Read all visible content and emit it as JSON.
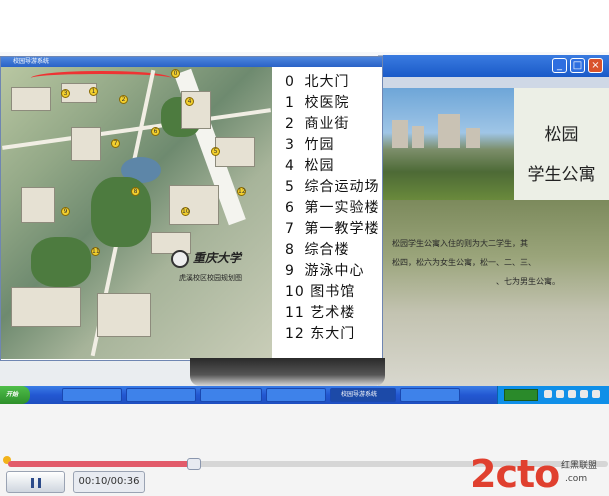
{
  "video": {
    "main_window_title": "校园导游系统",
    "legend": [
      {
        "num": "0",
        "label": "北大门"
      },
      {
        "num": "1",
        "label": "校医院"
      },
      {
        "num": "2",
        "label": "商业街"
      },
      {
        "num": "3",
        "label": "竹园"
      },
      {
        "num": "4",
        "label": "松园"
      },
      {
        "num": "5",
        "label": "综合运动场"
      },
      {
        "num": "6",
        "label": "第一实验楼"
      },
      {
        "num": "7",
        "label": "第一教学楼"
      },
      {
        "num": "8",
        "label": "综合楼"
      },
      {
        "num": "9",
        "label": "游泳中心"
      },
      {
        "num": "10",
        "label": "图书馆"
      },
      {
        "num": "11",
        "label": "艺术楼"
      },
      {
        "num": "12",
        "label": "东大门"
      }
    ],
    "map": {
      "university_name": "重庆大学",
      "campus_caption": "虎溪校区校园规划图",
      "pins": [
        "0",
        "1",
        "2",
        "3",
        "4",
        "5",
        "6",
        "7",
        "8",
        "9",
        "10",
        "11",
        "12"
      ]
    },
    "slide": {
      "title_line1": "松园",
      "title_line2": "学生公寓",
      "body_lines": [
        "松园学生公寓入住的则为大二学生，其",
        "松四，松六为女生公寓，松一、二、三、",
        "、七为男生公寓。"
      ]
    },
    "taskbar": {
      "start_label": "开始",
      "items": [
        "",
        "",
        "",
        "",
        "校园导游系统",
        ""
      ]
    }
  },
  "player": {
    "progress": 0.31,
    "time": "00:10/00:36",
    "watermark_main": "2cto",
    "watermark_domain": ".com",
    "watermark_brand": "红黑联盟"
  },
  "colors": {
    "accent": "#e25b6a",
    "watermark": "#e0402f",
    "taskbar": "#2358d2"
  }
}
